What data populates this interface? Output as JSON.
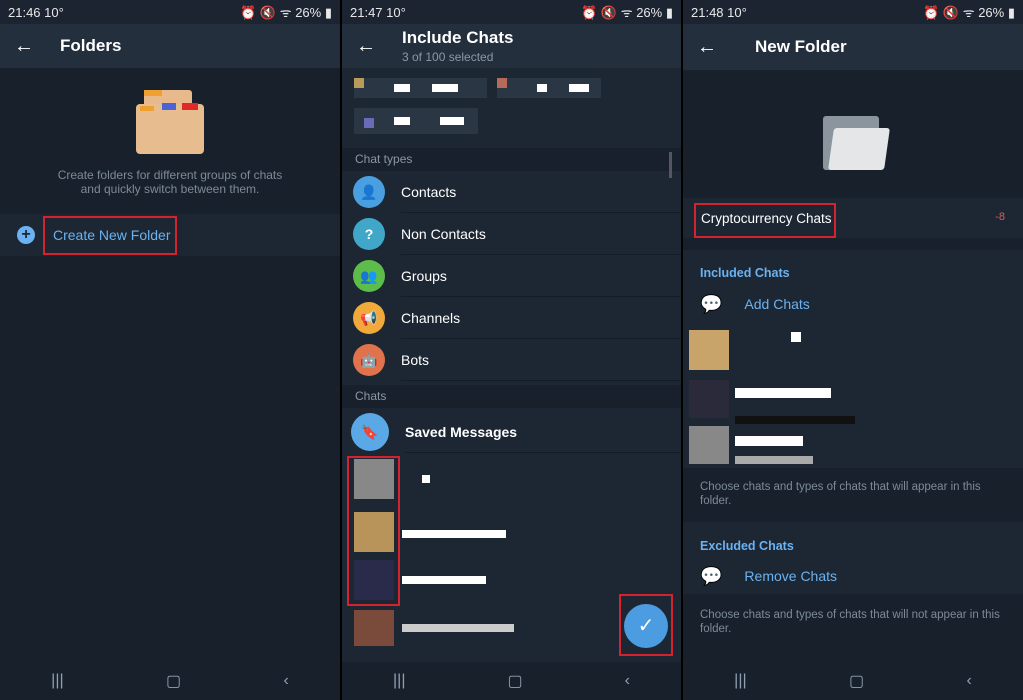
{
  "status": [
    {
      "time": "21:46",
      "temp": "10°",
      "battery": "26%"
    },
    {
      "time": "21:47",
      "temp": "10°",
      "battery": "26%"
    },
    {
      "time": "21:48",
      "temp": "10°",
      "battery": "26%"
    }
  ],
  "panel1": {
    "title": "Folders",
    "hint": "Create folders for different groups of chats and quickly switch between them.",
    "create_label": "Create New Folder"
  },
  "panel2": {
    "title": "Include Chats",
    "subtitle": "3 of 100 selected",
    "chat_types_header": "Chat types",
    "chat_types": [
      {
        "label": "Contacts",
        "icon": "person-icon",
        "color": "#4a9fe0"
      },
      {
        "label": "Non Contacts",
        "icon": "question-icon",
        "color": "#40a7c9"
      },
      {
        "label": "Groups",
        "icon": "group-icon",
        "color": "#5cbd4a"
      },
      {
        "label": "Channels",
        "icon": "megaphone-icon",
        "color": "#f2a93b"
      },
      {
        "label": "Bots",
        "icon": "bot-icon",
        "color": "#e0734b"
      }
    ],
    "chats_header": "Chats",
    "saved_label": "Saved Messages"
  },
  "panel3": {
    "title": "New Folder",
    "folder_name": "Cryptocurrency Chats",
    "char_counter": "-8",
    "included_header": "Included Chats",
    "add_chats": "Add Chats",
    "included_hint": "Choose chats and types of chats that will appear in this folder.",
    "excluded_header": "Excluded Chats",
    "remove_chats": "Remove Chats",
    "excluded_hint": "Choose chats and types of chats that will not appear in this folder."
  },
  "colors": {
    "accent": "#6ab2f2",
    "fab": "#4c9ce2",
    "highlight": "#d4222e"
  }
}
